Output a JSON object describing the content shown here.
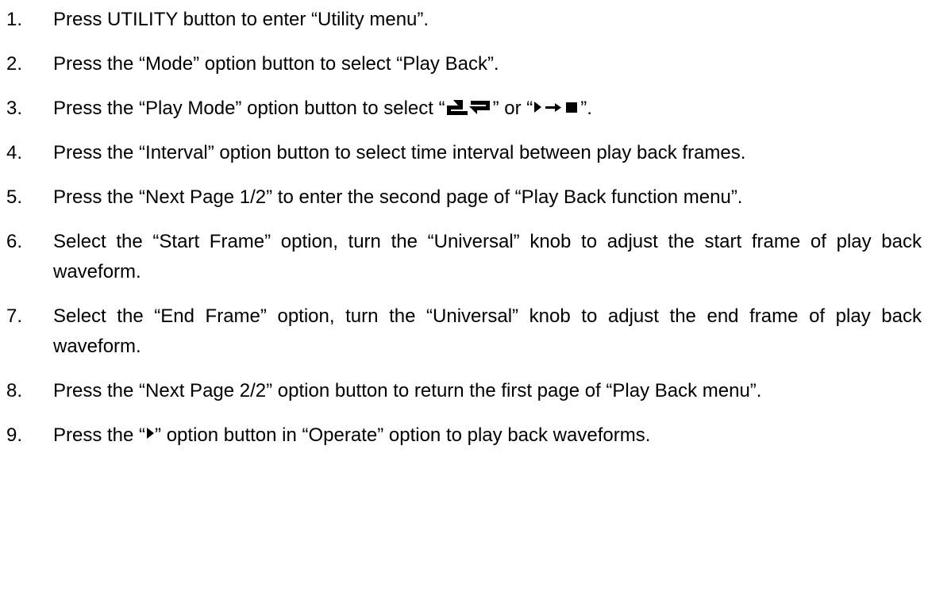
{
  "steps": [
    {
      "num": "1.",
      "text": "Press UTILITY button to enter “Utility menu”."
    },
    {
      "num": "2.",
      "text": "Press the “Mode” option button to select “Play Back”."
    },
    {
      "num": "3.",
      "text_before": "Press the “Play Mode” option button to select “",
      "text_mid": "” or “",
      "text_after": "”.",
      "icons": [
        "loop-play-icon",
        "play-to-stop-icon"
      ]
    },
    {
      "num": "4.",
      "text": "Press the “Interval” option button to select time interval between play back frames."
    },
    {
      "num": "5.",
      "text": "Press the “Next Page 1/2” to enter the second page of “Play Back function menu”."
    },
    {
      "num": "6.",
      "text": "Select the “Start Frame” option, turn the “Universal” knob to adjust the start frame of play back waveform."
    },
    {
      "num": "7.",
      "text": "Select the “End Frame” option, turn the “Universal” knob to adjust the end frame of play back waveform."
    },
    {
      "num": "8.",
      "text": "Press the “Next Page 2/2” option button to return the first page of “Play Back menu”."
    },
    {
      "num": "9.",
      "text_before": "Press the “",
      "text_after": "” option button in “Operate” option to play back waveforms.",
      "icons": [
        "play-icon"
      ]
    }
  ]
}
